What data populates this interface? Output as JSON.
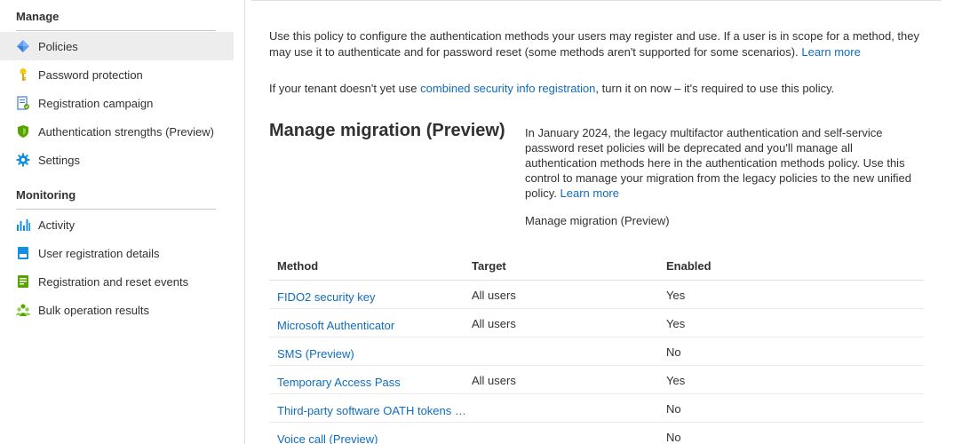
{
  "sidebar": {
    "manage_title": "Manage",
    "manage_items": [
      {
        "label": "Policies",
        "icon": "policies-diamond-icon",
        "active": true
      },
      {
        "label": "Password protection",
        "icon": "key-icon"
      },
      {
        "label": "Registration campaign",
        "icon": "registration-icon"
      },
      {
        "label": "Authentication strengths (Preview)",
        "icon": "shield-icon"
      },
      {
        "label": "Settings",
        "icon": "gear-icon"
      }
    ],
    "monitoring_title": "Monitoring",
    "monitoring_items": [
      {
        "label": "Activity",
        "icon": "bar-chart-icon"
      },
      {
        "label": "User registration details",
        "icon": "user-details-icon"
      },
      {
        "label": "Registration and reset events",
        "icon": "events-icon"
      },
      {
        "label": "Bulk operation results",
        "icon": "users-group-icon"
      }
    ]
  },
  "main": {
    "intro_text": "Use this policy to configure the authentication methods your users may register and use. If a user is in scope for a method, they may use it to authenticate and for password reset (some methods aren't supported for some scenarios).",
    "intro_link": "Learn more",
    "tenant_prefix": "If your tenant doesn't yet use",
    "tenant_link": "combined security info registration",
    "tenant_suffix": ", turn it on now – it's required to use this policy.",
    "migration": {
      "title": "Manage migration (Preview)",
      "description": "In January 2024, the legacy multifactor authentication and self-service password reset policies will be deprecated and you'll manage all authentication methods here in the authentication methods policy. Use this control to manage your migration from the legacy policies to the new unified policy.",
      "learn_more": "Learn more",
      "manage_link": "Manage migration (Preview)"
    },
    "table": {
      "headers": {
        "method": "Method",
        "target": "Target",
        "enabled": "Enabled"
      },
      "rows": [
        {
          "method": "FIDO2 security key",
          "target": "All users",
          "enabled": "Yes"
        },
        {
          "method": "Microsoft Authenticator",
          "target": "All users",
          "enabled": "Yes"
        },
        {
          "method": "SMS (Preview)",
          "target": "",
          "enabled": "No"
        },
        {
          "method": "Temporary Access Pass",
          "target": "All users",
          "enabled": "Yes"
        },
        {
          "method": "Third-party software OATH tokens …",
          "target": "",
          "enabled": "No"
        },
        {
          "method": "Voice call (Preview)",
          "target": "",
          "enabled": "No"
        }
      ]
    }
  },
  "colors": {
    "link": "#0f6cbd",
    "active_bg": "#ededed",
    "text": "#323130"
  }
}
